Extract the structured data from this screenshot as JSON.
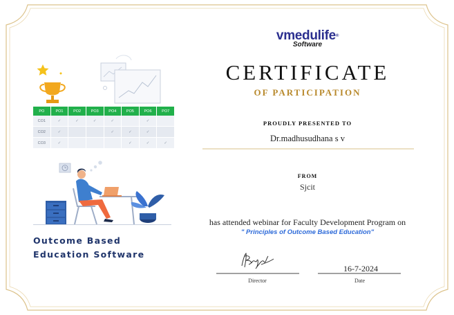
{
  "brand": {
    "name_a": "vmedu",
    "name_b": "life",
    "name_tm": "®",
    "sub": "Software"
  },
  "certificate": {
    "title": "CERTIFICATE",
    "subtitle": "OF PARTICIPATION",
    "presented_label": "PROUDLY PRESENTED TO",
    "recipient": "Dr.madhusudhana s v",
    "from_label": "FROM",
    "organization": "Sjcit",
    "attended_text": "has attended webinar for Faculty Development Program on",
    "program": "\" Principles of Outcome Based Education\"",
    "date": "16-7-2024",
    "signature_label": "Director",
    "date_label": "Date"
  },
  "left_panel": {
    "title_line1": "Outcome Based",
    "title_line2": "Education Software"
  },
  "po_table": {
    "headers": [
      "PO",
      "PO1",
      "PO2",
      "PO3",
      "PO4",
      "PO5",
      "PO6",
      "PO7"
    ],
    "rows": [
      [
        "CO1",
        "✓",
        "✓",
        "✓",
        "✓",
        "",
        "✓",
        ""
      ],
      [
        "CO2",
        "✓",
        "",
        "",
        "✓",
        "✓",
        "✓",
        ""
      ],
      [
        "CO3",
        "✓",
        "",
        "",
        "",
        "✓",
        "✓",
        "✓"
      ]
    ]
  },
  "colors": {
    "border_gold": "#dcc28a",
    "title_gold": "#b8892c",
    "brand_blue": "#2b2f8f",
    "table_green": "#21b04b",
    "program_blue": "#2d6ad9",
    "navy": "#20356b"
  }
}
